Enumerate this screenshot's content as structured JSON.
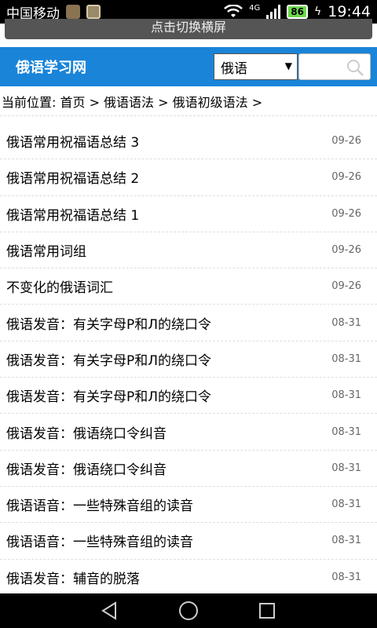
{
  "status_bar": {
    "carrier": "中国移动",
    "network": "4G",
    "battery": "86",
    "time": "19:44"
  },
  "toggle": {
    "label": "点击切换横屏"
  },
  "header": {
    "site_title": "俄语学习网",
    "category_select": "俄语"
  },
  "breadcrumb": {
    "text": "当前位置: 首页 > 俄语语法 > 俄语初级语法 >"
  },
  "articles": [
    {
      "title": "俄语常用祝福语总结 3",
      "date": "09-26"
    },
    {
      "title": "俄语常用祝福语总结 2",
      "date": "09-26"
    },
    {
      "title": "俄语常用祝福语总结 1",
      "date": "09-26"
    },
    {
      "title": "俄语常用词组",
      "date": "09-26"
    },
    {
      "title": "不变化的俄语词汇",
      "date": "09-26"
    },
    {
      "title": "俄语发音：有关字母Р和Л的绕口令",
      "date": "08-31"
    },
    {
      "title": "俄语发音：有关字母Р和Л的绕口令",
      "date": "08-31"
    },
    {
      "title": "俄语发音：有关字母Р和Л的绕口令",
      "date": "08-31"
    },
    {
      "title": "俄语发音：俄语绕口令纠音",
      "date": "08-31"
    },
    {
      "title": "俄语发音：俄语绕口令纠音",
      "date": "08-31"
    },
    {
      "title": "俄语语音：一些特殊音组的读音",
      "date": "08-31"
    },
    {
      "title": "俄语语音：一些特殊音组的读音",
      "date": "08-31"
    },
    {
      "title": "俄语发音：辅音的脱落",
      "date": "08-31"
    }
  ],
  "colors": {
    "header_bg": "#1a84d8",
    "battery": "#6bd84a"
  }
}
